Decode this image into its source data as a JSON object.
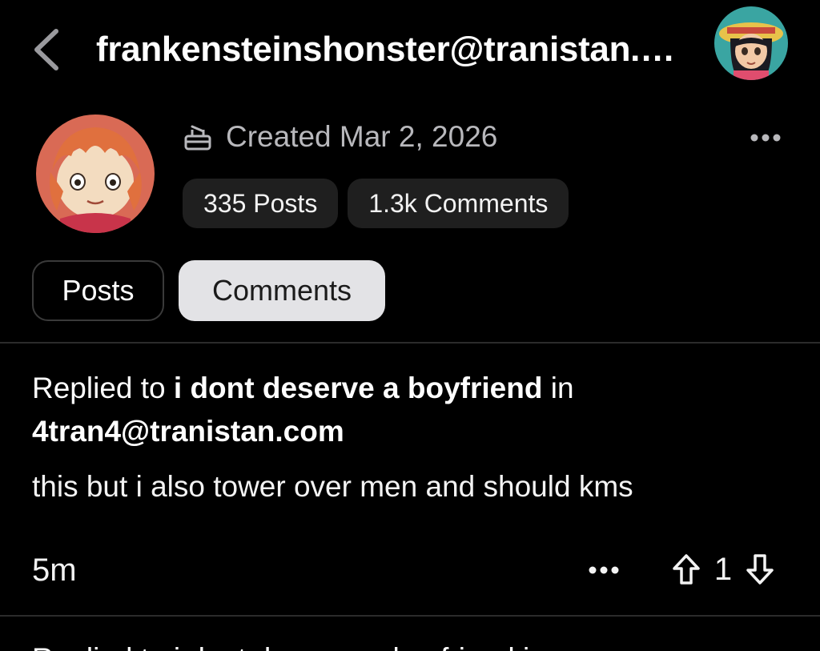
{
  "header": {
    "title": "frankensteinshonster@tranistan.c…",
    "back_icon": "chevron-left-icon",
    "account_avatar": "user-avatar"
  },
  "profile": {
    "created_label": "Created Mar 2, 2026",
    "created_icon": "cake-icon",
    "stats": {
      "posts": "335 Posts",
      "comments": "1.3k Comments"
    },
    "more_icon": "more-horizontal-icon"
  },
  "tabs": [
    {
      "label": "Posts",
      "selected": false
    },
    {
      "label": "Comments",
      "selected": true
    }
  ],
  "comments": [
    {
      "prefix": "Replied to",
      "post_title": "i dont deserve a boyfriend",
      "connector": "in",
      "community": "4tran4@tranistan.com",
      "body": "this but i also tower over men and should kms",
      "time": "5m",
      "score": "1",
      "more_icon": "more-horizontal-icon",
      "upvote_icon": "arrow-up-icon",
      "downvote_icon": "arrow-down-icon"
    }
  ],
  "next_comment_preview": "Replied to i dont deserve a boyfriend in",
  "colors": {
    "background": "#000000",
    "pill": "#1f1f1f",
    "tab_selected": "#e3e3e6",
    "muted_text": "#b8b8bc",
    "divider": "#2b2b2b"
  }
}
